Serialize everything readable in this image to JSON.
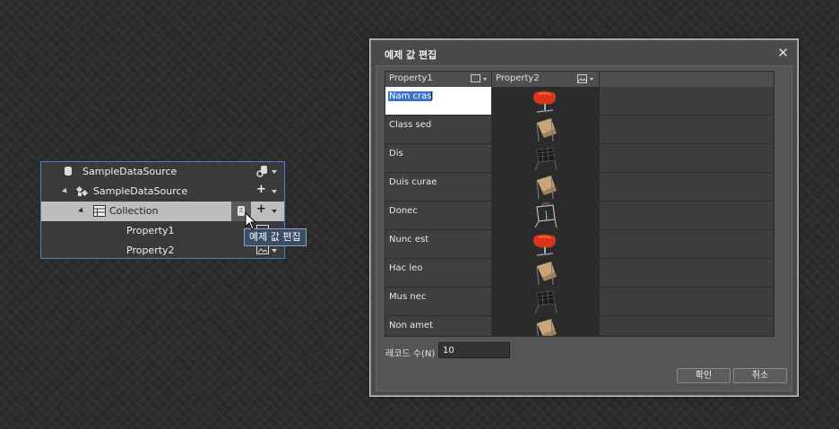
{
  "data_panel": {
    "rows": [
      {
        "label": "SampleDataSource"
      },
      {
        "label": "SampleDataSource"
      },
      {
        "label": "Collection"
      },
      {
        "label": "Property1"
      },
      {
        "label": "Property2"
      }
    ]
  },
  "tooltip": {
    "text": "예제 값 편집"
  },
  "dialog": {
    "title": "예제 값 편집",
    "close": "✕",
    "columns": [
      {
        "header": "Property1",
        "type_icon": "text-type-icon"
      },
      {
        "header": "Property2",
        "type_icon": "image-type-icon"
      }
    ],
    "rows": [
      {
        "property1": "Nam cras",
        "chair": "red-swan-chair",
        "editing": true
      },
      {
        "property1": "Class sed",
        "chair": "tan-sling-chair"
      },
      {
        "property1": "Dis",
        "chair": "black-wire-chair"
      },
      {
        "property1": "Duis curae",
        "chair": "tan-sling-chair"
      },
      {
        "property1": "Donec",
        "chair": "wire-frame-chair"
      },
      {
        "property1": "Nunc est",
        "chair": "red-swan-chair"
      },
      {
        "property1": "Hac leo",
        "chair": "tan-sling-chair"
      },
      {
        "property1": "Mus nec",
        "chair": "black-wire-chair"
      },
      {
        "property1": "Non amet",
        "chair": "tan-sling-chair"
      }
    ],
    "record_count_label": "레코드 수(N)",
    "record_count_value": "10",
    "ok_label": "확인",
    "cancel_label": "취소"
  }
}
